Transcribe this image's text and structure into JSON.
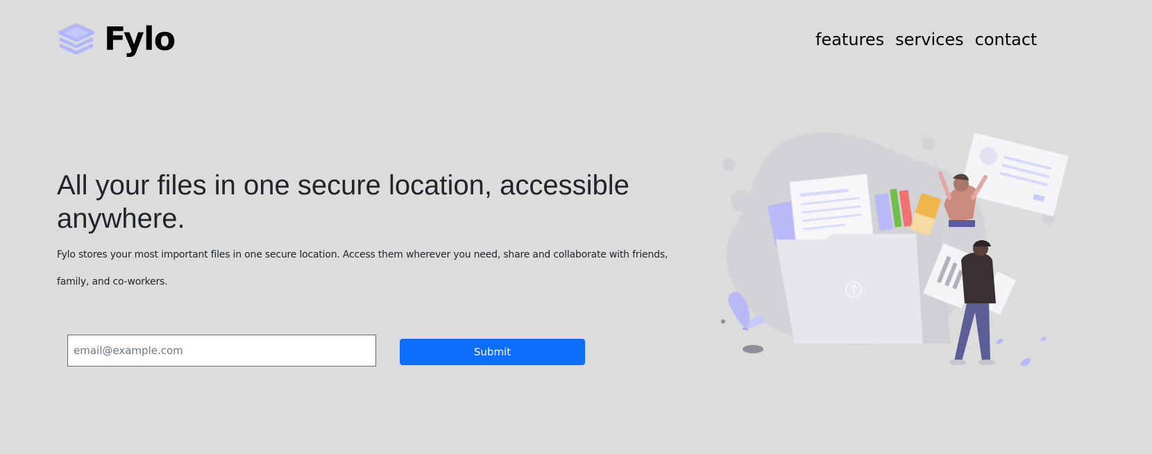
{
  "brand": {
    "name": "Fylo",
    "logo_icon": "stacked-layers-icon",
    "logo_color": "#b2b6fb"
  },
  "nav": {
    "items": [
      {
        "label": "features"
      },
      {
        "label": "services"
      },
      {
        "label": "contact"
      }
    ]
  },
  "hero": {
    "title": "All your files in one secure location, accessible anywhere.",
    "description": "Fylo stores your most important files in one secure location. Access them wherever you need, share and collaborate with friends, family, and co-workers.",
    "illustration": "people-sharing-files-illustration"
  },
  "form": {
    "email_placeholder": "email@example.com",
    "email_value": "",
    "submit_label": "Submit"
  },
  "colors": {
    "background": "#dcdcdc",
    "primary_button": "#0d6efd",
    "accent": "#b2b6fb"
  }
}
